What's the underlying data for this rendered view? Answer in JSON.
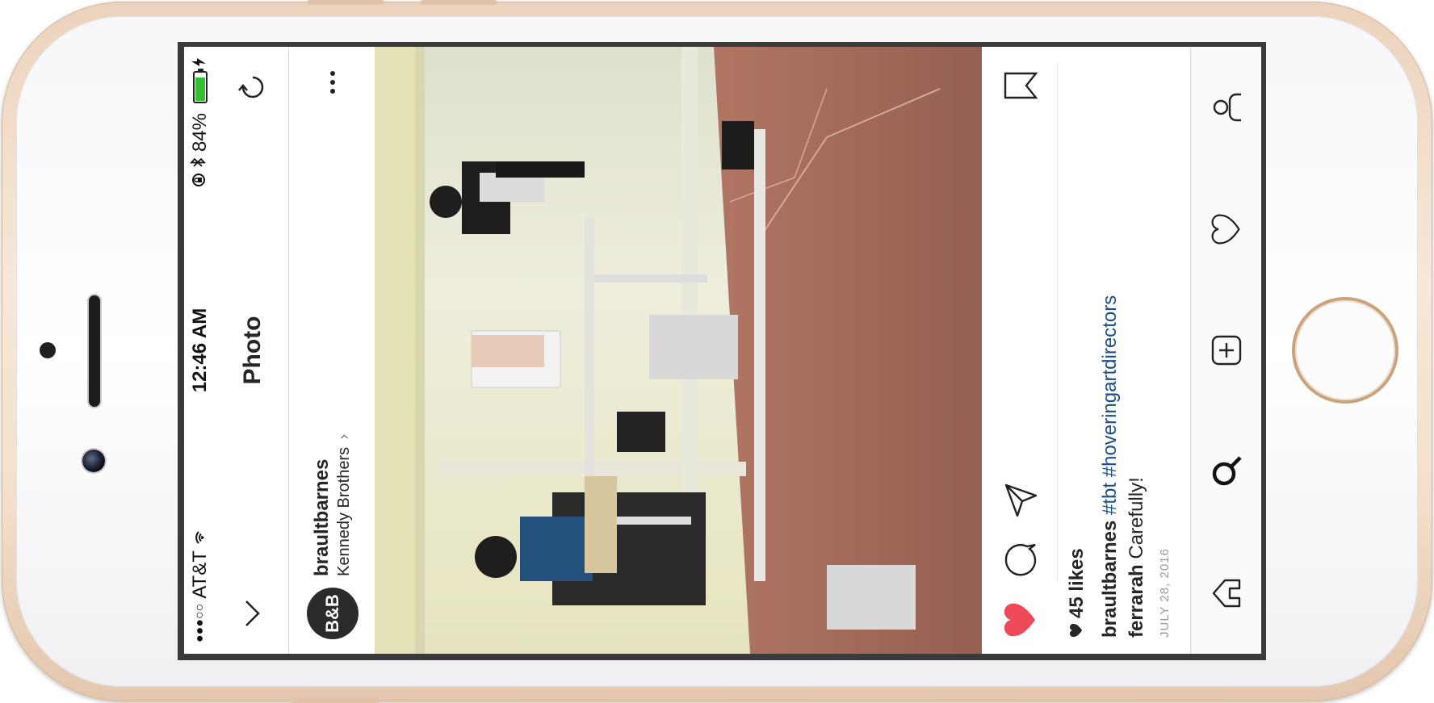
{
  "status_bar": {
    "carrier": "AT&T",
    "signal": "●●●○○",
    "time": "12:46 AM",
    "battery_percent": "84%",
    "battery_level": 0.84,
    "battery_color": "#34c034"
  },
  "nav": {
    "title": "Photo",
    "back_icon": "chevron-down-icon",
    "refresh_icon": "refresh-icon"
  },
  "post": {
    "avatar_text": "B&B",
    "username": "braultbarnes",
    "location": "Kennedy Brothers",
    "location_arrow": "›",
    "likes": "45 likes",
    "caption_user": "braultbarnes",
    "caption_tags": [
      "#tbt",
      "#hoveringartdirectors"
    ],
    "comment_user": "ferrarah",
    "comment_text": "Carefully!",
    "date": "JULY 28, 2016",
    "liked": true,
    "like_color": "#ed4956",
    "hashtag_color": "#1b4e8a"
  }
}
